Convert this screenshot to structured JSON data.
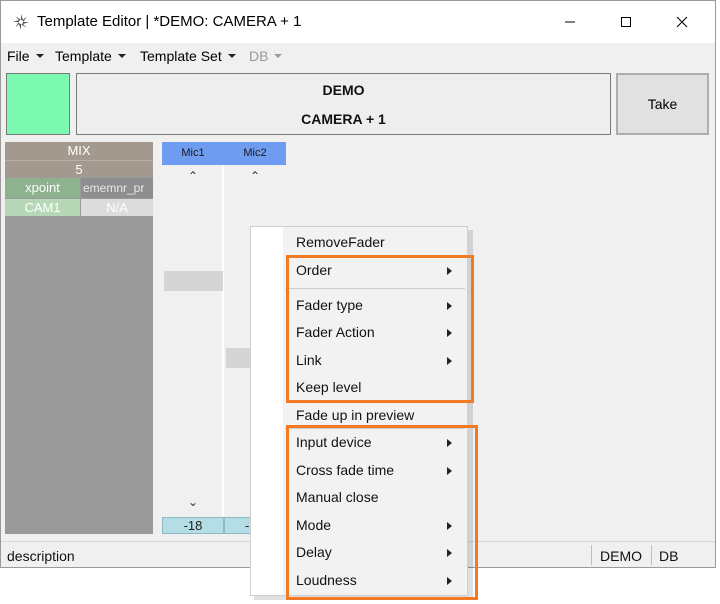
{
  "window": {
    "title": "Template Editor | *DEMO: CAMERA + 1",
    "icon": "app-logo-icon",
    "controls": [
      "minimize-icon",
      "maximize-icon",
      "close-icon"
    ]
  },
  "menubar": {
    "items": [
      {
        "label": "File",
        "enabled": true
      },
      {
        "label": "Template",
        "enabled": true
      },
      {
        "label": "Template Set",
        "enabled": true
      },
      {
        "label": "DB",
        "enabled": false
      }
    ]
  },
  "header": {
    "swatch_color": "#7cf9b0",
    "line1": "DEMO",
    "line2": "CAMERA + 1",
    "take_label": "Take"
  },
  "mix": {
    "title": "MIX",
    "number": "5",
    "xpoint_label": "xpoint",
    "col2_header": "ememnr_pr",
    "cam_value": "CAM1",
    "na_value": "N/A"
  },
  "faders": [
    {
      "label": "Mic1",
      "value": "-18",
      "level": 0.62
    },
    {
      "label": "Mic2",
      "value": "-",
      "level": 0.45
    }
  ],
  "statusbar": {
    "description": "description",
    "site": "DEMO",
    "db": "DB"
  },
  "context_menu": {
    "items": [
      {
        "label": "RemoveFader",
        "submenu": false
      },
      {
        "label": "Order",
        "submenu": true
      },
      {
        "label": "Fader type",
        "submenu": true
      },
      {
        "label": "Fader Action",
        "submenu": true
      },
      {
        "label": "Link",
        "submenu": true
      },
      {
        "label": "Keep level",
        "submenu": false
      },
      {
        "label": "Fade up in preview",
        "submenu": false
      },
      {
        "label": "Input device",
        "submenu": true
      },
      {
        "label": "Cross fade time",
        "submenu": true
      },
      {
        "label": "Manual close",
        "submenu": false
      },
      {
        "label": "Mode",
        "submenu": true
      },
      {
        "label": "Delay",
        "submenu": true
      },
      {
        "label": "Loudness",
        "submenu": true
      }
    ]
  },
  "colors": {
    "highlight": "#f27a24",
    "mic_header": "#6e9cf0",
    "mix_header": "#a3998e",
    "xpoint": "#8db28d"
  }
}
